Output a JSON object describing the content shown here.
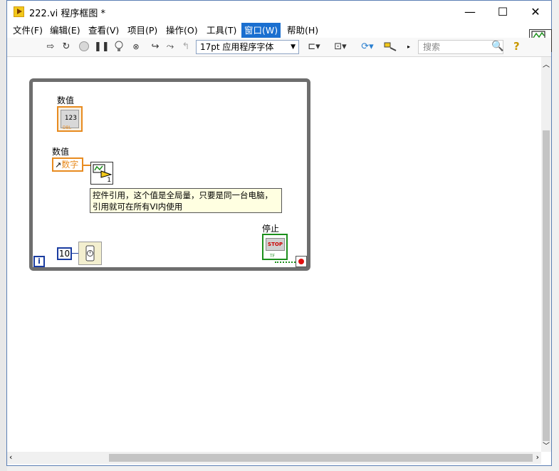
{
  "window": {
    "title": "222.vi 程序框图 *",
    "minimize": "—",
    "maximize": "☐",
    "close": "✕"
  },
  "menu": {
    "items": [
      {
        "label": "文件(F)"
      },
      {
        "label": "编辑(E)"
      },
      {
        "label": "查看(V)"
      },
      {
        "label": "项目(P)"
      },
      {
        "label": "操作(O)"
      },
      {
        "label": "工具(T)"
      },
      {
        "label": "窗口(W)"
      },
      {
        "label": "帮助(H)"
      }
    ]
  },
  "toolbar": {
    "font_select_value": "17pt 应用程序字体",
    "search_placeholder": "搜索"
  },
  "diagram": {
    "numeric_label": "数值",
    "numeric_value": "123",
    "numeric_type": "DBL",
    "property_label": "数值",
    "property_text": "数字",
    "subvi_count": "1",
    "comment_line1": "控件引用，这个值是全局量，只要是同一台电脑，",
    "comment_line2": "引用就可在所有VI内使用",
    "constant_value": "10",
    "stop_label": "停止",
    "stop_face": "STOP",
    "stop_type": "TF",
    "iteration_terminal": "i",
    "vi_icon_count": "2"
  }
}
